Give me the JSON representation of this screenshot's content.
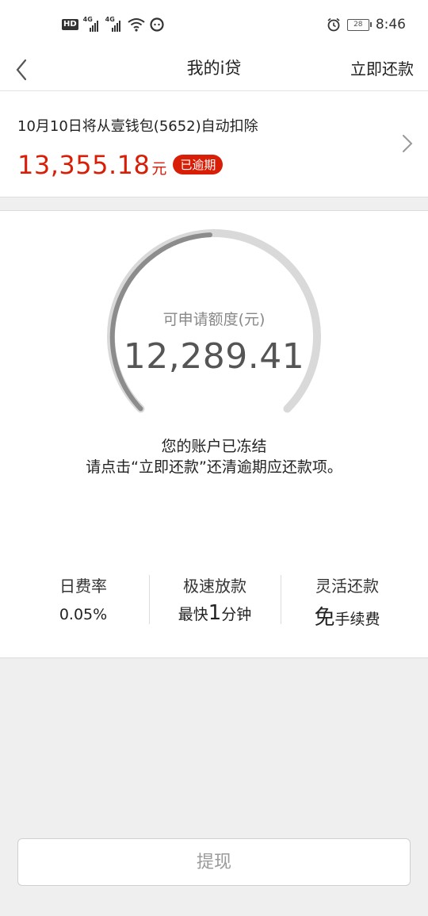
{
  "status_bar": {
    "hd_badge": "HD",
    "signal_1_label": "4G",
    "signal_2_label": "4G",
    "battery_level": "28",
    "time": "8:46"
  },
  "nav": {
    "title": "我的i贷",
    "repay_now": "立即还款"
  },
  "bill": {
    "description": "10月10日将从壹钱包(5652)自动扣除",
    "amount": "13,355.18",
    "unit": "元",
    "status_badge": "已逾期"
  },
  "quota": {
    "label": "可申请额度(元)",
    "value": "12,289.41",
    "frozen_line_1": "您的账户已冻结",
    "frozen_line_2": "请点击“立即还款”还清逾期应还款项。"
  },
  "features": [
    {
      "title": "日费率",
      "value_prefix": "",
      "value_big": "",
      "value_suffix": "0.05%"
    },
    {
      "title": "极速放款",
      "value_prefix": "最快",
      "value_big": "1",
      "value_suffix": "分钟"
    },
    {
      "title": "灵活还款",
      "value_prefix": "",
      "value_big": "免",
      "value_suffix": "手续费"
    }
  ],
  "withdraw_button": "提现",
  "colors": {
    "accent_red": "#d81e06",
    "gauge_track": "#d9d9d9",
    "gauge_progress": "#8c8c8c"
  }
}
